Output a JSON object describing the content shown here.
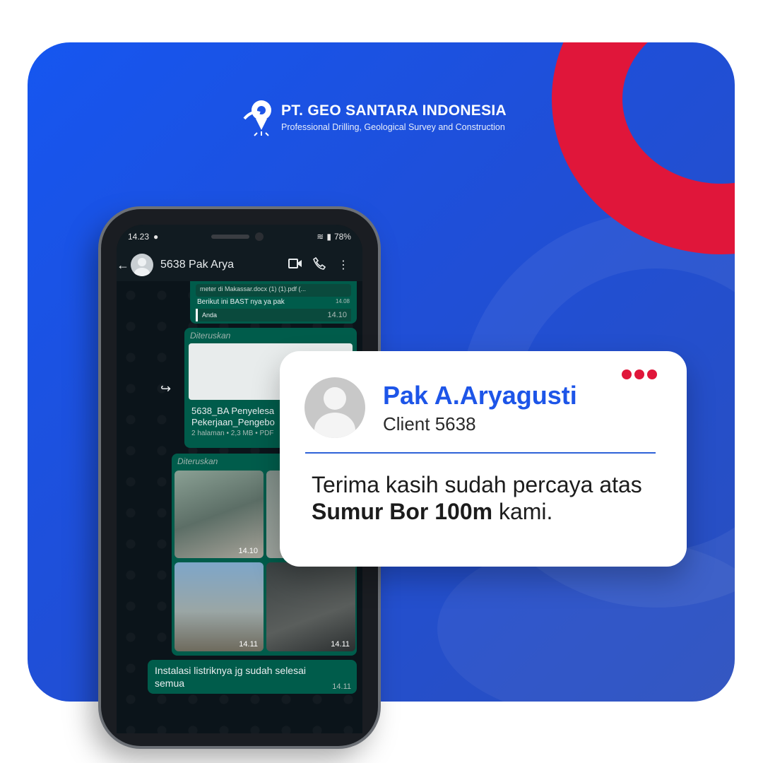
{
  "brand": {
    "title": "PT. GEO SANTARA INDONESIA",
    "subtitle": "Professional Drilling, Geological Survey and Construction",
    "colors": {
      "blue": "#1d55e8",
      "red": "#e0163a"
    }
  },
  "phone": {
    "status": {
      "time": "14.23",
      "battery": "78%"
    },
    "header": {
      "contact": "5638 Pak Arya"
    },
    "messages": {
      "doc_top": {
        "filename": "meter di Makassar.docx (1) (1).pdf (...",
        "time_small": "14.08",
        "caption": "Berikut ini BAST nya ya pak",
        "reply_author": "Anda",
        "time": "14.10"
      },
      "fwd1": {
        "label": "Diteruskan",
        "title_line1": "5638_BA Penyelesa",
        "title_line2": "Pekerjaan_Pengebo",
        "meta": "2 halaman • 2,3 MB • PDF"
      },
      "fwd2": {
        "label": "Diteruskan",
        "photo_times": [
          "14.10",
          "14.11",
          "14.11"
        ]
      },
      "last": {
        "text": "Instalasi listriknya jg sudah selesai semua",
        "time": "14.11"
      }
    }
  },
  "testimonial": {
    "name": "Pak A.Aryagusti",
    "role": "Client 5638",
    "quote_pre": "Terima kasih sudah percaya atas ",
    "quote_bold": "Sumur Bor 100m",
    "quote_post": " kami."
  }
}
